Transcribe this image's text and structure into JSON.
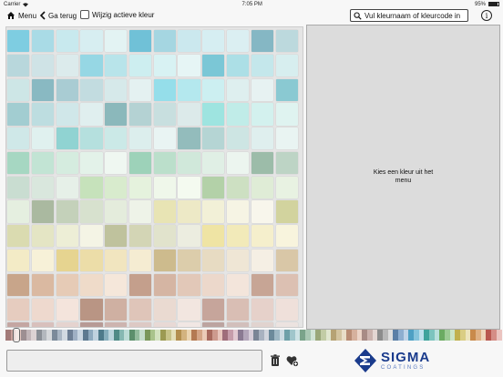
{
  "status": {
    "carrier": "Carrier",
    "time": "7:05 PM",
    "battery": "95%"
  },
  "toolbar": {
    "menu_label": "Menu",
    "back_label": "Ga terug",
    "toggle_label": "Wijzig actieve kleur"
  },
  "search": {
    "placeholder": "Vul kleurnaam of kleurcode in"
  },
  "detail": {
    "message": "Kies een kleur uit het menu"
  },
  "logo": {
    "name": "SIGMA",
    "sub": "COATINGS"
  },
  "colors": {
    "brand": "#1a3b8c",
    "swatch_rows": [
      [
        "#7ecde1",
        "#a9dbe6",
        "#c8e9ee",
        "#d7eef1",
        "#e3f3f3",
        "#70c1d7",
        "#a5d6e1",
        "#cbe8ee",
        "#d6eef2",
        "#dbeff2",
        "#85b7c4",
        "#bcd9dd"
      ],
      [
        "#b8d7dc",
        "#cfe3e6",
        "#dcebec",
        "#96d7e4",
        "#b8e4ea",
        "#cdeef0",
        "#d8f2f3",
        "#e6f5f5",
        "#7bc7d6",
        "#acdfe6",
        "#c4e7eb",
        "#d7eeef"
      ],
      [
        "#cde6e6",
        "#89b9c2",
        "#a9ccd3",
        "#c2dce0",
        "#d6e9ea",
        "#e4f1f1",
        "#95deea",
        "#b4e8ee",
        "#cceff1",
        "#deefef",
        "#e7f2f2",
        "#8ac9d2"
      ],
      [
        "#a2cdd1",
        "#bddde0",
        "#d0e7e9",
        "#e0efef",
        "#8bb8bb",
        "#b4d2d3",
        "#c8dfdf",
        "#dceaea",
        "#9ee4e0",
        "#c0ece8",
        "#d3f1ee",
        "#dff3f0"
      ],
      [
        "#cfe8e8",
        "#e0f1ef",
        "#90d3d2",
        "#b5e0de",
        "#cbe9e7",
        "#dceeed",
        "#e9f4f3",
        "#93bcbc",
        "#b5d5d4",
        "#cde5e3",
        "#dfefee",
        "#e9f4f2"
      ],
      [
        "#a6d7c2",
        "#c2e4d4",
        "#d5ecdf",
        "#e3f2e9",
        "#eff7f1",
        "#9dd2b9",
        "#bbdfcb",
        "#d0e8da",
        "#e0efe5",
        "#ecf5ef",
        "#9cbca9",
        "#bdd4c5"
      ],
      [
        "#c9ddd1",
        "#d9e7dd",
        "#e6f0e8",
        "#c6e2bb",
        "#d8ebcd",
        "#e5f2dd",
        "#eff7ea",
        "#f4faf0",
        "#b3d1a8",
        "#cde0c2",
        "#dfecd6",
        "#e8f2e2"
      ],
      [
        "#e5efe0",
        "#aab9a0",
        "#c4d1ba",
        "#d7e1ce",
        "#e4ecdc",
        "#eef3e8",
        "#e8e4b4",
        "#ede9c6",
        "#f2f0d7",
        "#f6f4e4",
        "#f8f6ec",
        "#d2d39e"
      ],
      [
        "#dadbb0",
        "#e4e5c4",
        "#edeed6",
        "#f4f4e5",
        "#bfc29d",
        "#d3d5b5",
        "#e1e3cc",
        "#ecede0",
        "#efe4a4",
        "#f2eab9",
        "#f5efcc",
        "#f8f4dd"
      ],
      [
        "#f3ebc6",
        "#f7f1d8",
        "#e6d490",
        "#ecdda8",
        "#f1e5bf",
        "#f5ecd2",
        "#cdbb8d",
        "#dccdab",
        "#e7dbc2",
        "#efe6d5",
        "#f5efe4",
        "#d9c7a7"
      ],
      [
        "#c8a58a",
        "#dab9a1",
        "#e6cbb6",
        "#efdbc9",
        "#f5e7da",
        "#c49f8c",
        "#d5b5a3",
        "#e2c8b8",
        "#ecd8cb",
        "#f3e5db",
        "#c7a595",
        "#dcc0b2"
      ],
      [
        "#e6ccbf",
        "#eed9ce",
        "#f4e4dc",
        "#b99584",
        "#cfb0a2",
        "#dfc5b9",
        "#eadad1",
        "#f2e6e0",
        "#c6a59b",
        "#d9beb4",
        "#e6d1ca",
        "#efe0da"
      ],
      [
        "#c4a6a2",
        "#d8c0bc",
        "#e5d3cf",
        "#b79a95",
        "#cdb4af",
        "#ddc9c4",
        "#e8d9d5",
        "#f1e7e4",
        "#bca4a0",
        "#d2bfbb",
        "#e1d3cf",
        "#ece3e0"
      ]
    ],
    "strip": [
      "#a27a78",
      "#c8a09b",
      "#e3c7c0",
      "#9d8f92",
      "#c1b5b8",
      "#dcd2d3",
      "#8a8f96",
      "#b3b8be",
      "#d5d8db",
      "#7b8a9a",
      "#a9b6c4",
      "#d2dae2",
      "#6d7f95",
      "#9fb0c4",
      "#c9d6e2",
      "#5c7990",
      "#8eaabf",
      "#bfd2df",
      "#4e7a8a",
      "#86aebc",
      "#bad4dc",
      "#4f8a86",
      "#86b8b2",
      "#bcdcd6",
      "#5c8f6c",
      "#93bb9d",
      "#c5dccb",
      "#7a9659",
      "#a9c38b",
      "#d3e2bf",
      "#9c9a52",
      "#c7c388",
      "#e4e0b9",
      "#b38f4f",
      "#d3b37f",
      "#ebd4b1",
      "#b47a52",
      "#d4a586",
      "#ebcbb7",
      "#a86a5e",
      "#cd9a8e",
      "#e8c6bd",
      "#9f6d7a",
      "#c69daa",
      "#e2c9d1",
      "#8a7a92",
      "#b3a6ba",
      "#d6cdd9",
      "#7a8596",
      "#a8b2c0",
      "#d0d5dd",
      "#6c8a9b",
      "#9eb8c5",
      "#ccdbe2",
      "#6ea0a8",
      "#a0c6cb",
      "#cde3e5",
      "#7aa38a",
      "#a9c7b3",
      "#d1e3d6",
      "#9aa77a",
      "#c2cca5",
      "#e0e6cf",
      "#b6a274",
      "#d3c39f",
      "#e9ddc7",
      "#b98c74",
      "#d6b19d",
      "#ecd4c7",
      "#a88b85",
      "#cbb2ad",
      "#e4d6d2",
      "#8c8c8c",
      "#b8b8b8",
      "#dedede",
      "#5b7fa6",
      "#8eaed0",
      "#bfd3e8",
      "#4fa0c4",
      "#86c4dc",
      "#bde0ec",
      "#3fa39c",
      "#7cc4be",
      "#b8e0dc",
      "#6bab62",
      "#9ccb94",
      "#cbe4c6",
      "#c1b04d",
      "#dacd84",
      "#ede4bd",
      "#c98a4b",
      "#dfb083",
      "#efd5bb",
      "#b9574f",
      "#d58d86",
      "#ebc4c0"
    ]
  }
}
